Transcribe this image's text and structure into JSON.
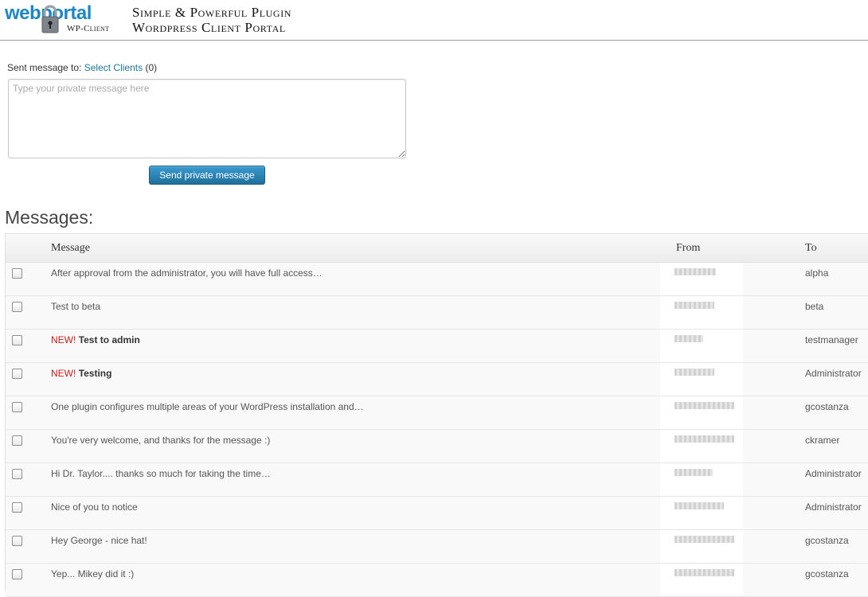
{
  "header": {
    "logo_web": "web",
    "logo_portal": "portal",
    "logo_sub": "WP-Client",
    "tagline_line1": "Simple & Powerful Plugin",
    "tagline_line2": "Wordpress Client Portal"
  },
  "compose": {
    "sent_to_label": "Sent message to:",
    "select_clients_link": "Select Clients",
    "selected_count": "(0)",
    "message_placeholder": "Type your private message here",
    "message_value": "",
    "send_button": "Send private message"
  },
  "messages": {
    "title": "Messages:",
    "columns": {
      "message": "Message",
      "from": "From",
      "to": "To"
    },
    "rows": [
      {
        "new_tag": "",
        "text": "After approval from the administrator, you will have full access…",
        "bold": false,
        "to": "alpha"
      },
      {
        "new_tag": "",
        "text": "Test to beta",
        "bold": false,
        "to": "beta"
      },
      {
        "new_tag": "NEW!",
        "text": "Test to admin",
        "bold": true,
        "to": "testmanager"
      },
      {
        "new_tag": "NEW!",
        "text": "Testing",
        "bold": true,
        "to": "Administrator"
      },
      {
        "new_tag": "",
        "text": "One plugin configures multiple areas of your WordPress installation and…",
        "bold": false,
        "to": "gcostanza"
      },
      {
        "new_tag": "",
        "text": "You're very welcome, and thanks for the message :)",
        "bold": false,
        "to": "ckramer"
      },
      {
        "new_tag": "",
        "text": "Hi Dr. Taylor.... thanks so much for taking the time…",
        "bold": false,
        "to": "Administrator"
      },
      {
        "new_tag": "",
        "text": "Nice of you to notice",
        "bold": false,
        "to": "Administrator"
      },
      {
        "new_tag": "",
        "text": "Hey George - nice hat!",
        "bold": false,
        "to": "gcostanza"
      },
      {
        "new_tag": "",
        "text": "Yep... Mikey did it :)",
        "bold": false,
        "to": "gcostanza"
      }
    ]
  },
  "colors": {
    "link": "#21759b",
    "new_tag": "#cc1a1a",
    "button": "#2a86bb",
    "logo_blue": "#1d86c4"
  }
}
